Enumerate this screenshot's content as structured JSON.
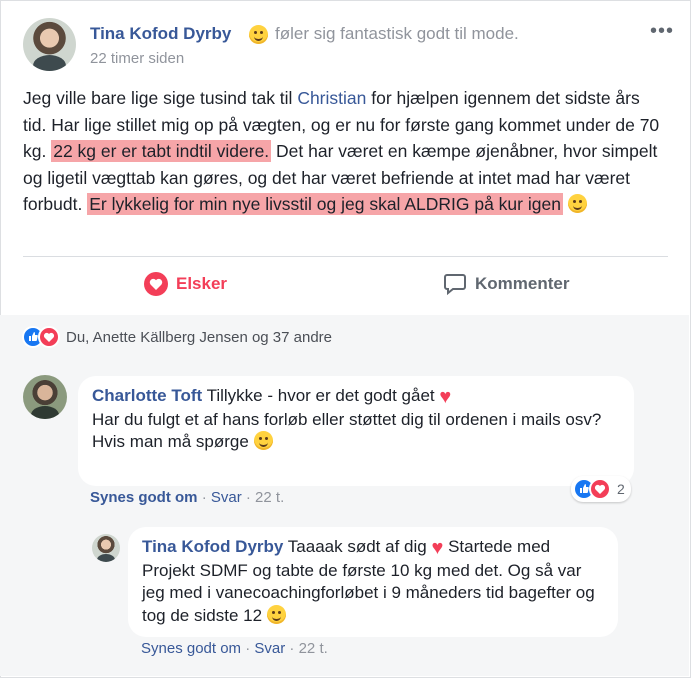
{
  "post": {
    "author": "Tina Kofod Dyrby",
    "feeling_icon": "laughing-emoji-icon",
    "feeling": "føler sig fantastisk godt til mode.",
    "timestamp": "22 timer siden",
    "more_label": "•••",
    "text": {
      "p1": "Jeg ville bare lige sige tusind tak til ",
      "mention": "Christian",
      "p2": " for hjælpen igennem det sidste års tid. Har lige stillet mig op på vægten, og er nu for første gang kommet under de 70 kg. ",
      "highlight1": "22 kg er er tabt indtil videre.",
      "p3": " Det har været en kæmpe øjenåbner, hvor simpelt og ligetil vægttab kan gøres, og det har været befriende at intet mad har været forbudt. ",
      "highlight2": "Er lykkelig for min nye livsstil og jeg skal ALDRIG på kur igen"
    },
    "highlight_color": "#f6a5a8"
  },
  "actions": {
    "love_label": "Elsker",
    "comment_label": "Kommenter",
    "love_color": "#f33e58"
  },
  "reactions_summary": {
    "icons": [
      "like-icon",
      "love-icon"
    ],
    "text": "Du, Anette Källberg Jensen og 37 andre"
  },
  "comments": [
    {
      "author": "Charlotte Toft",
      "line1": "Tillykke - hvor er det godt gået",
      "line2": "Har du fulgt et af hans forløb eller støttet dig til ordenen i mails osv?",
      "line3": "Hvis man må spørge",
      "like_label": "Synes godt om",
      "reply_label": "Svar",
      "time": "22 t.",
      "reaction_count": "2"
    },
    {
      "author": "Tina Kofod Dyrby",
      "line1": "Taaaak sødt af dig",
      "line2": "Startede med Projekt SDMF og tabte de første 10 kg med det. Og så var jeg med i vanecoachingforløbet i 9 måneders tid bagefter og tog de sidste 12",
      "like_label": "Synes godt om",
      "reply_label": "Svar",
      "time": "22 t."
    }
  ],
  "separator": "·"
}
